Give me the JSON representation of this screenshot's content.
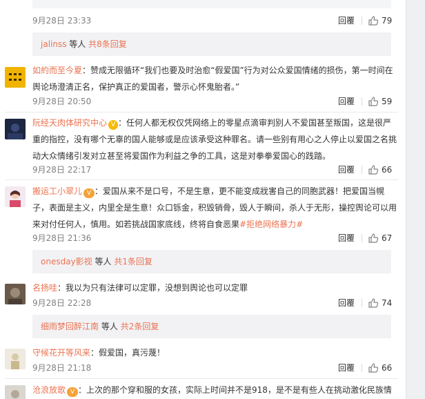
{
  "colors": {
    "link": "#eb7350",
    "reply_bg": "#f2f2f5",
    "meta": "#808080"
  },
  "icons": {
    "like": "thumbs-up-icon"
  },
  "labels": {
    "reply": "回覆",
    "people_suffix": "等人",
    "more_prefix": "共",
    "more_suffix": "条回复"
  },
  "top_comment": {
    "date": "9月28日 23:33",
    "likes": "79"
  },
  "reply_box_1": {
    "name": "jalinss",
    "people": "等人",
    "more": "共8条回复"
  },
  "comments": [
    {
      "user": "如約而至今夏",
      "text": "：赞成无限循环“我们也要及时治愈“假爱国”行为对公众爱国情绪的损伤，第一时间在舆论场澄清正名，保护真正的爱国者，警示心怀鬼胎者。”",
      "date": "9月28日 20:50",
      "likes": "59"
    },
    {
      "user": "阮经天肉体研究中心",
      "badge": "V",
      "text": "：任何人都无权仅凭网络上的零星点滴审判别人不爱国甚至叛国，这是很严重的指控，没有哪个无辜的国人能够或是应该承受这种罪名。请一些别有用心之人停止以爱国之名挑动大众情绪引发对立甚至将爱国作为利益之争的工具，这是对拳拳爱国心的践踏。",
      "date": "9月28日 22:17",
      "likes": "66"
    },
    {
      "user": "搬运工小翠儿",
      "badge": "V",
      "text": "：爱国从来不是口号，不是生意，更不能变成戕害自己的同胞武器！把爱国当幌子，表面是主义，内里全是生意！众口铄金，积毁销骨，毁人于瞬间，杀人于无形，操控舆论可以用来对付任何人，慎用。如若挑战国家底线，终将自食恶果",
      "hashtag": "#拒绝网络暴力#",
      "date": "9月28日 21:36",
      "likes": "67"
    },
    {
      "user": "名扬哇",
      "text": "：我以为只有法律可以定罪，没想到舆论也可以定罪",
      "date": "9月28日 22:28",
      "likes": "74"
    },
    {
      "user": "守候花开等风来",
      "text": "：假爱国，真污蔑！",
      "date": "9月28日 21:18",
      "likes": "66"
    },
    {
      "user": "沧浪放歌",
      "badge": "V",
      "text": "：上次的那个穿和服的女孩，实际上时间并不是918，是不是有些人在挑动激化民族情"
    }
  ],
  "reply_box_2": {
    "name": "onesday影视",
    "people": "等人",
    "more": "共1条回复"
  },
  "reply_box_3": {
    "name": "细雨梦回醉江南",
    "people": "等人",
    "more": "共2条回复"
  }
}
